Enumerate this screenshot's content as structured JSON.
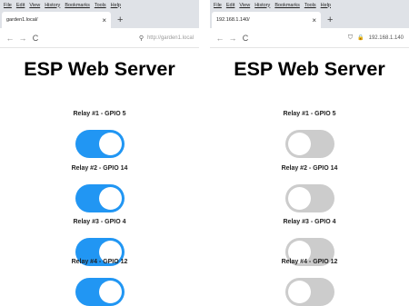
{
  "menu": [
    "File",
    "Edit",
    "View",
    "History",
    "Bookmarks",
    "Tools",
    "Help"
  ],
  "left_window": {
    "tab_title": "garden1.local/",
    "url_placeholder": "http://garden1.local",
    "page_title": "ESP Web Server",
    "relays": [
      {
        "label": "Relay #1 - GPIO 5",
        "state": "on"
      },
      {
        "label": "Relay #2 - GPIO 14",
        "state": "on"
      },
      {
        "label": "Relay #3 - GPIO 4",
        "state": "on"
      },
      {
        "label": "Relay #4 - GPIO 12",
        "state": "on"
      }
    ]
  },
  "right_window": {
    "tab_title": "192.168.1.140/",
    "url": "192.168.1.140",
    "page_title": "ESP Web Server",
    "relays": [
      {
        "label": "Relay #1 - GPIO 5",
        "state": "off"
      },
      {
        "label": "Relay #2 - GPIO 14",
        "state": "off"
      },
      {
        "label": "Relay #3 - GPIO 4",
        "state": "off"
      },
      {
        "label": "Relay #4 - GPIO 12",
        "state": "off"
      }
    ]
  },
  "icons": {
    "close": "×",
    "new_tab": "+",
    "back": "←",
    "forward": "→",
    "reload": "C",
    "search": "⚲",
    "shield": "⛉",
    "lock": "🔒"
  },
  "colors": {
    "switch_on": "#2196f3",
    "switch_off": "#cccccc",
    "chrome": "#dfe2e7"
  }
}
